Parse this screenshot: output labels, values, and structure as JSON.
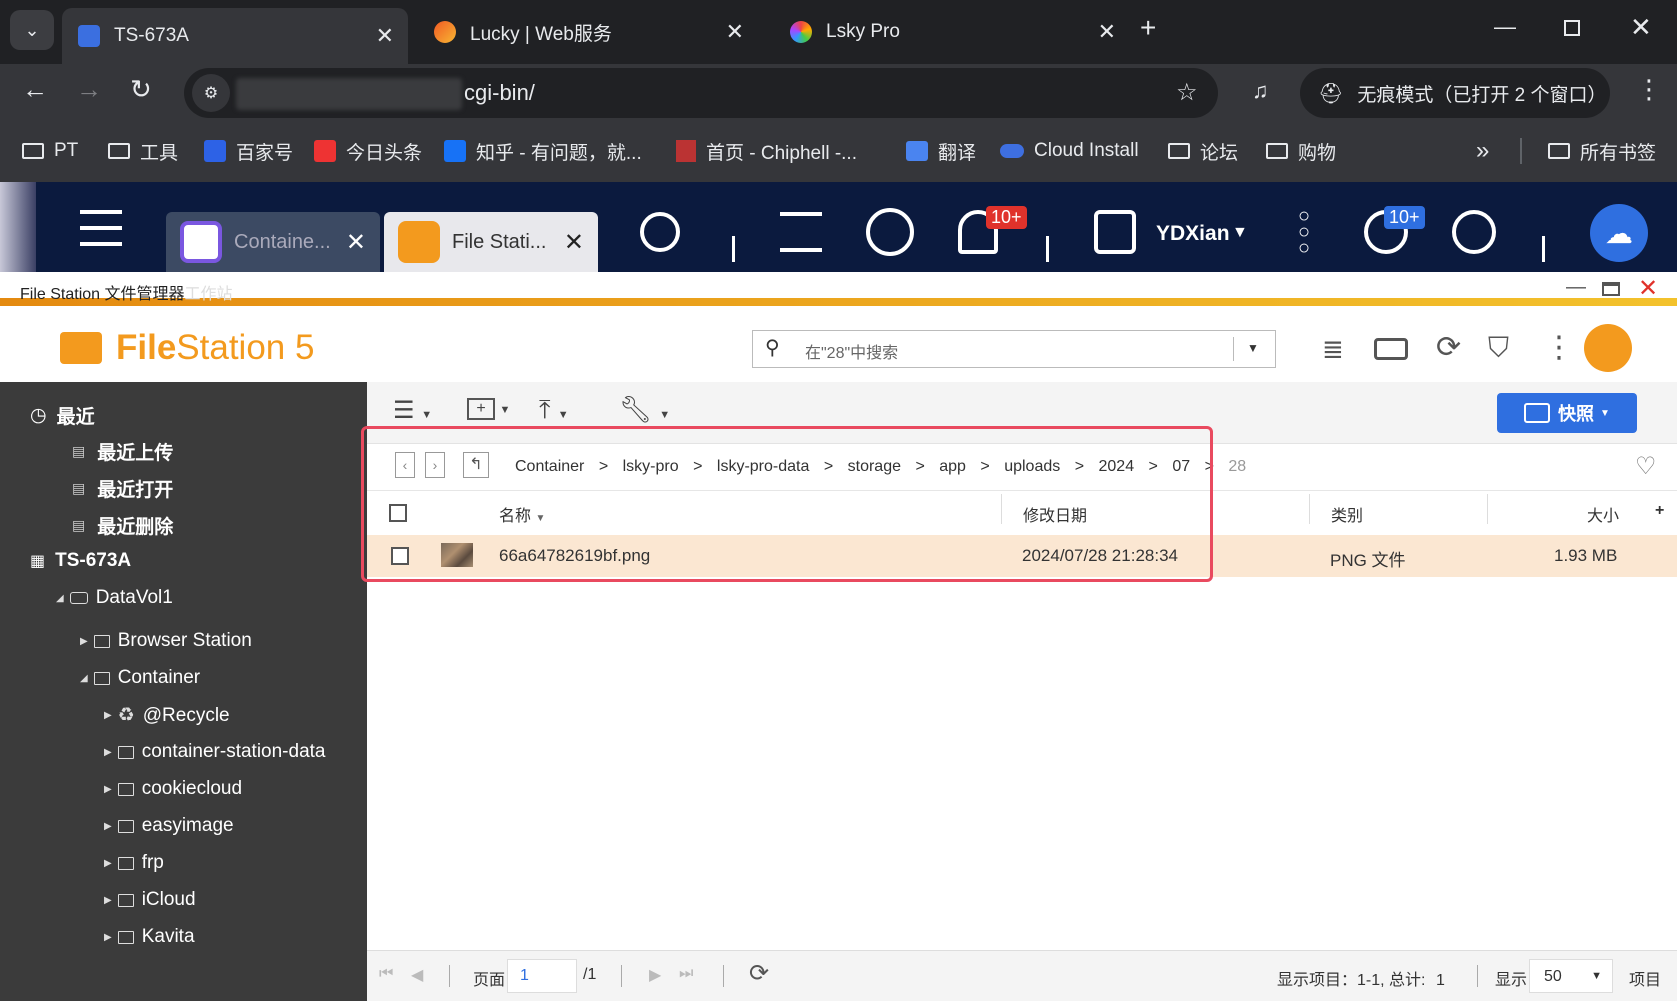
{
  "browser": {
    "tabs": [
      {
        "title": "TS-673A",
        "active": true
      },
      {
        "title": "Lucky | Web服务",
        "active": false
      },
      {
        "title": "Lsky Pro",
        "active": false
      }
    ],
    "address": "cgi-bin/",
    "incognito_label": "无痕模式（已打开 2 个窗口）",
    "bookmarks": [
      "PT",
      "工具",
      "百家号",
      "今日头条",
      "知乎 - 有问题，就...",
      "首页 - Chiphell -...",
      "翻译",
      "Cloud Install",
      "论坛",
      "购物"
    ],
    "bookmarks_more": "»",
    "all_bookmarks": "所有书签"
  },
  "qnap": {
    "tabs": [
      {
        "title": "Containe...",
        "active": false
      },
      {
        "title": "File Stati...",
        "active": true
      }
    ],
    "notification_badge": "10+",
    "user": "YDXian",
    "update_badge": "10+"
  },
  "filestation": {
    "window_title": "File Station 文件管理器",
    "window_title_ghost": "工作站",
    "app_name_bold": "File",
    "app_name_rest": "Station 5",
    "search_placeholder": "在\"28\"中搜索",
    "snapshot_label": "快照",
    "sidebar": {
      "recent": "最近",
      "recent_items": [
        "最近上传",
        "最近打开",
        "最近删除"
      ],
      "nas": "TS-673A",
      "volume": "DataVol1",
      "folders": [
        "Browser Station",
        "Container"
      ],
      "container_children": [
        "@Recycle",
        "container-station-data",
        "cookiecloud",
        "easyimage",
        "frp",
        "iCloud",
        "Kavita"
      ]
    },
    "breadcrumb": [
      "Container",
      "lsky-pro",
      "lsky-pro-data",
      "storage",
      "app",
      "uploads",
      "2024",
      "07",
      "28"
    ],
    "breadcrumb_sep": ">",
    "columns": {
      "name": "名称",
      "modified": "修改日期",
      "type": "类别",
      "size": "大小"
    },
    "files": [
      {
        "name": "66a64782619bf.png",
        "modified": "2024/07/28 21:28:34",
        "type": "PNG 文件",
        "size": "1.93 MB"
      }
    ],
    "footer": {
      "page_label": "页面",
      "page_value": "1",
      "page_total": "/1",
      "items_label": "显示项目：",
      "items_range": "1-1,",
      "total_label": "总计:",
      "total_value": "1",
      "show_label": "显示",
      "per_page": "50",
      "items_unit": "项目"
    }
  },
  "colors": {
    "accent_orange": "#f39a1e",
    "snapshot_blue": "#2f6fe0",
    "highlight_red": "#e94a5f",
    "qnap_bar": "#0b1a3e",
    "row_highlight": "#fbe7d2"
  }
}
